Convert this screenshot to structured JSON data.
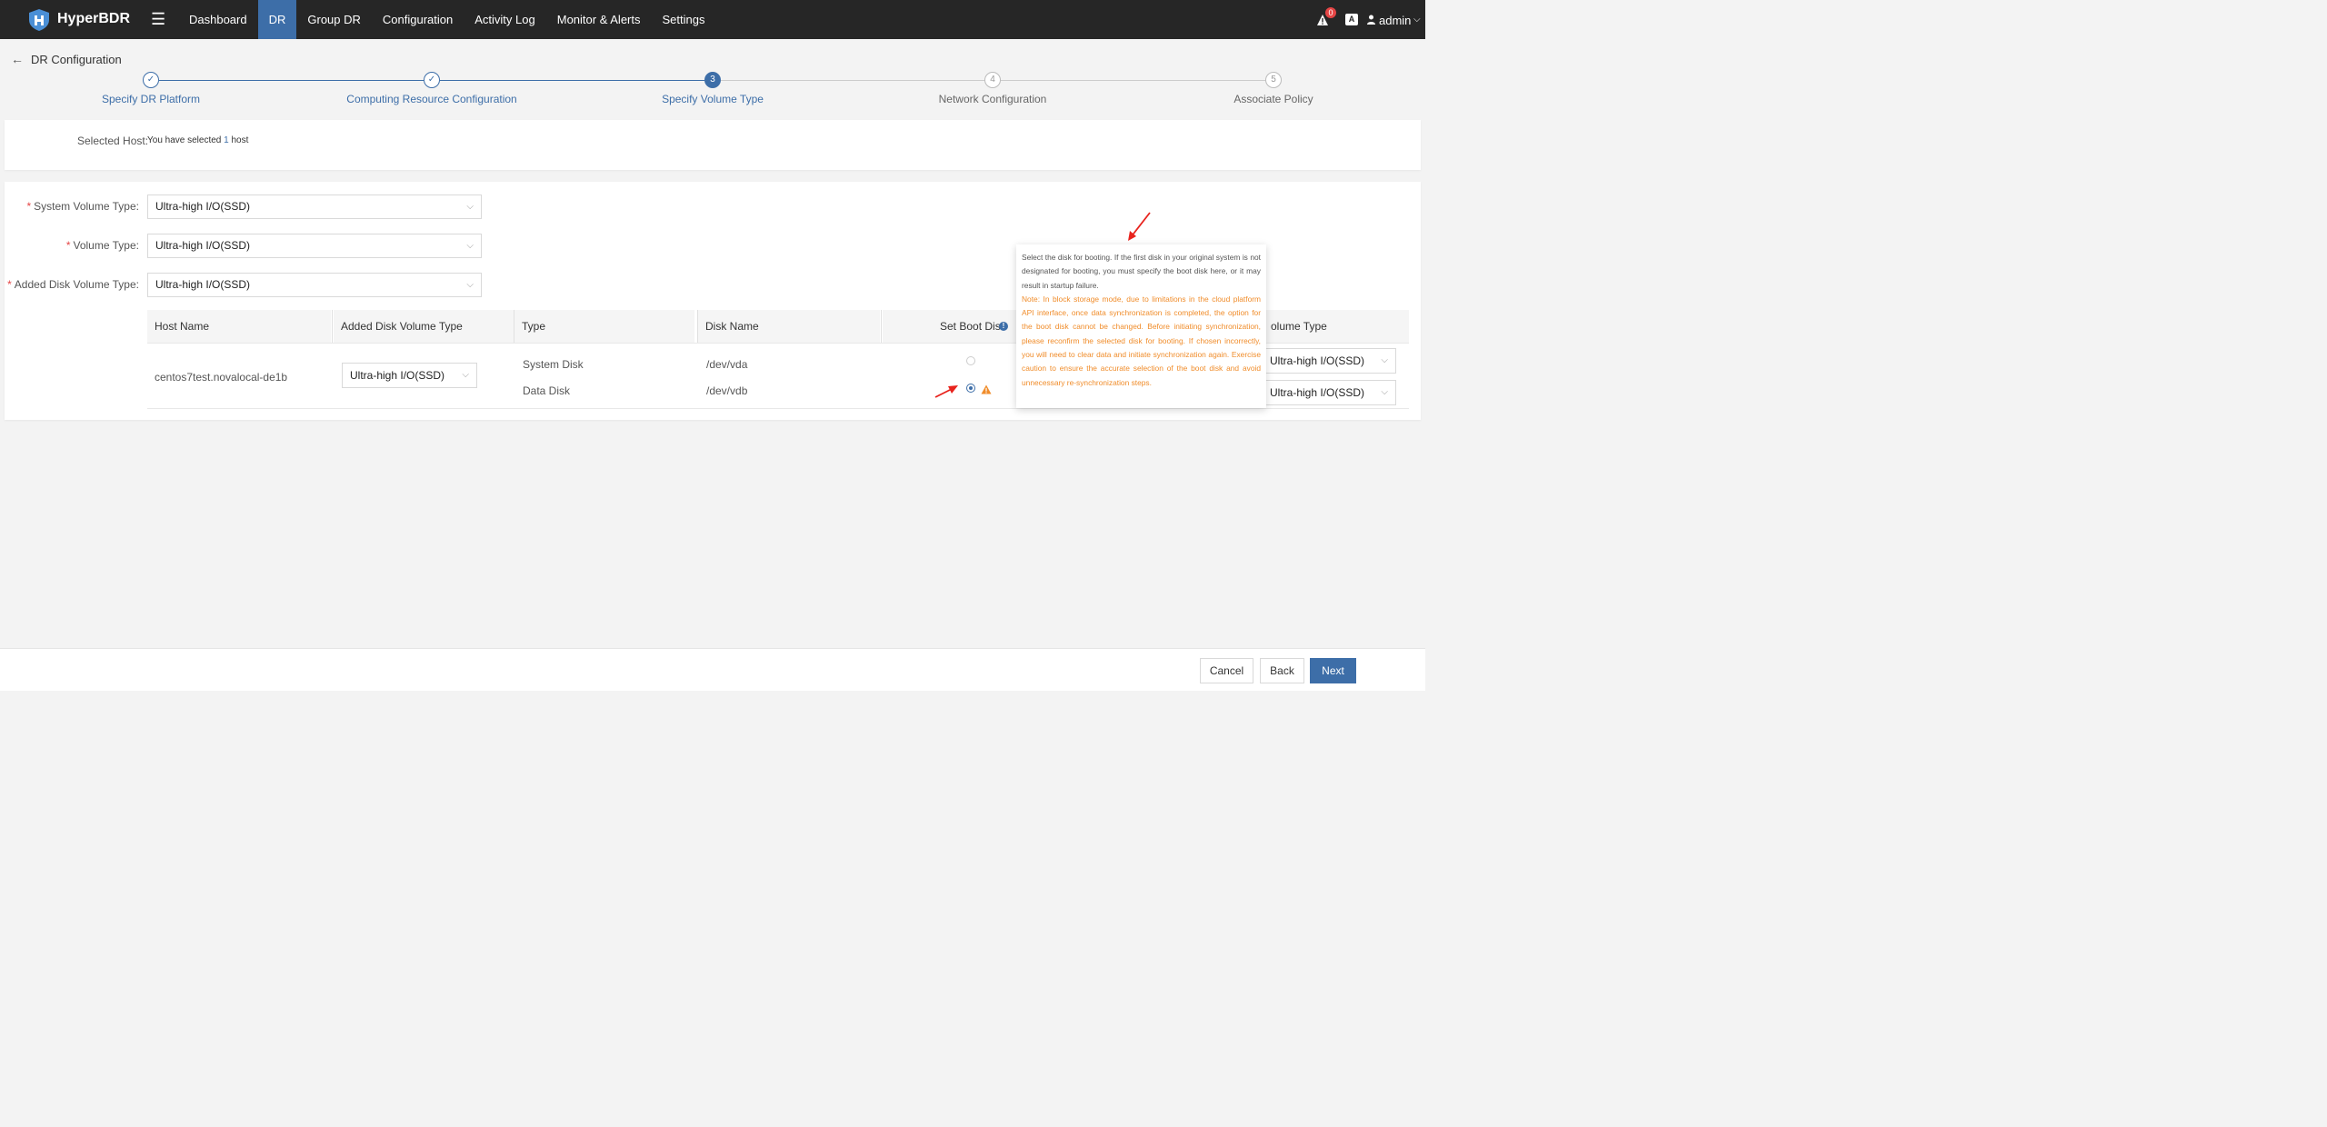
{
  "app": {
    "name": "HyperBDR"
  },
  "nav": [
    {
      "label": "Dashboard",
      "active": false
    },
    {
      "label": "DR",
      "active": true
    },
    {
      "label": "Group DR",
      "active": false
    },
    {
      "label": "Configuration",
      "active": false
    },
    {
      "label": "Activity Log",
      "active": false
    },
    {
      "label": "Monitor & Alerts",
      "active": false
    },
    {
      "label": "Settings",
      "active": false
    }
  ],
  "topbar": {
    "alert_count": "0",
    "lang_glyph": "A",
    "user": "admin"
  },
  "page": {
    "title": "DR Configuration"
  },
  "steps": [
    {
      "num": "1",
      "label": "Specify DR Platform",
      "status": "done"
    },
    {
      "num": "2",
      "label": "Computing Resource Configuration",
      "status": "done"
    },
    {
      "num": "3",
      "label": "Specify Volume Type",
      "status": "current"
    },
    {
      "num": "4",
      "label": "Network Configuration",
      "status": "todo"
    },
    {
      "num": "5",
      "label": "Associate Policy",
      "status": "todo"
    }
  ],
  "selected_host": {
    "label": "Selected Host:",
    "prefix": "You have selected",
    "count": "1",
    "suffix": "host"
  },
  "form": {
    "system_volume": {
      "label": "System Volume Type:",
      "value": "Ultra-high I/O(SSD)"
    },
    "volume": {
      "label": "Volume Type:",
      "value": "Ultra-high I/O(SSD)"
    },
    "added_disk": {
      "label": "Added Disk Volume Type:",
      "value": "Ultra-high I/O(SSD)"
    }
  },
  "table": {
    "columns": [
      "Host Name",
      "Added Disk Volume Type",
      "Type",
      "Disk Name",
      "Set Boot Disk",
      "olume Type"
    ],
    "row": {
      "host": "centos7test.novalocal-de1b",
      "added_disk_type": "Ultra-high I/O(SSD)",
      "disks": [
        {
          "type": "System Disk",
          "name": "/dev/vda",
          "boot": false,
          "volume_type": "Ultra-high I/O(SSD)"
        },
        {
          "type": "Data Disk",
          "name": "/dev/vdb",
          "boot": true,
          "volume_type": "Ultra-high I/O(SSD)"
        }
      ]
    }
  },
  "tooltip": {
    "main": "Select the disk for booting. If the first disk in your original system is not designated for booting, you must specify the boot disk here, or it may result in startup failure.",
    "note": "Note: In block storage mode, due to limitations in the cloud platform API interface, once data synchronization is completed, the option for the boot disk cannot be changed. Before initiating synchronization, please reconfirm the selected disk for booting. If chosen incorrectly, you will need to clear data and initiate synchronization again. Exercise caution to ensure the accurate selection of the boot disk and avoid unnecessary re-synchronization steps."
  },
  "footer": {
    "cancel": "Cancel",
    "back": "Back",
    "next": "Next"
  },
  "icons": {
    "logo": "shield-logo-icon",
    "menu": "hamburger-icon",
    "alert": "alert-triangle-icon",
    "lang": "translate-icon",
    "user": "user-icon",
    "back": "arrow-left-icon",
    "check": "check-icon",
    "chevron": "chevron-down-icon",
    "info": "info-icon",
    "warning": "warning-icon",
    "annotation": "red-arrow-icon"
  },
  "colors": {
    "accent": "#3d6ea8",
    "topbar": "#262626",
    "warning": "#f08c2a",
    "danger": "#e54545"
  }
}
